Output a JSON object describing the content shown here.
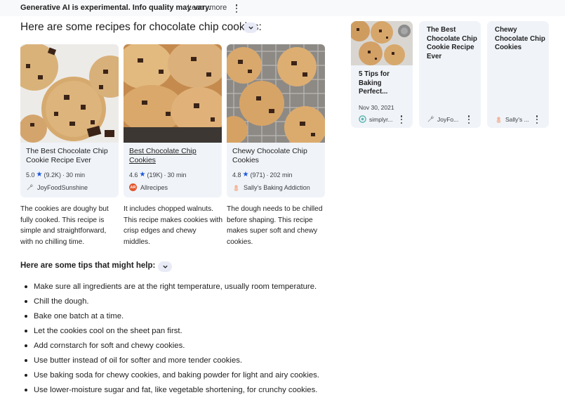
{
  "notice": {
    "text": "Generative AI is experimental. Info quality may vary.",
    "learn_more": "Learn more"
  },
  "heading": "Here are some recipes for chocolate chip cookies:",
  "recipes": [
    {
      "title": "The Best Chocolate Chip Cookie Recipe Ever",
      "rating": "5.0",
      "reviews": "(9.2K)",
      "time": "30 min",
      "source": "JoyFoodSunshine",
      "description": "The cookies are doughy but fully cooked. This recipe is simple and straightforward, with no chilling time."
    },
    {
      "title": "Best Chocolate Chip Cookies",
      "rating": "4.6",
      "reviews": "(19K)",
      "time": "30 min",
      "source": "Allrecipes",
      "source_badge": "AR",
      "description": "It includes chopped walnuts. This recipe makes cookies with crisp edges and chewy middles."
    },
    {
      "title": "Chewy Chocolate Chip Cookies",
      "rating": "4.8",
      "reviews": "(971)",
      "time": "202 min",
      "source": "Sally's Baking Addiction",
      "description": "The dough needs to be chilled before shaping. This recipe makes super soft and chewy cookies."
    }
  ],
  "meta_sep": "·",
  "star": "★",
  "tips_heading": "Here are some tips that might help:",
  "tips": [
    "Make sure all ingredients are at the right temperature, usually room temperature.",
    "Chill the dough.",
    "Bake one batch at a time.",
    "Let the cookies cool on the sheet pan first.",
    "Add cornstarch for soft and chewy cookies.",
    "Use butter instead of oil for softer and more tender cookies.",
    "Use baking soda for chewy cookies, and baking powder for light and airy cookies.",
    "Use lower-moisture sugar and fat, like vegetable shortening, for crunchy cookies."
  ],
  "sources": [
    {
      "title": "5 Tips for Baking Perfect...",
      "date": "Nov 30, 2021",
      "site": "simplyr..."
    },
    {
      "title": "The Best Chocolate Chip Cookie Recipe Ever",
      "site": "JoyFo..."
    },
    {
      "title": "Chewy Chocolate Chip Cookies",
      "site": "Sally's ..."
    }
  ],
  "icons": {
    "more": "kebab-menu-icon",
    "expand": "chevron-down-icon",
    "rating": "star-icon"
  },
  "colors": {
    "card_bg": "#f0f4f9",
    "star": "#1a56db",
    "chip_bg": "#e8eaf6",
    "allrecipes": "#e4572e"
  }
}
